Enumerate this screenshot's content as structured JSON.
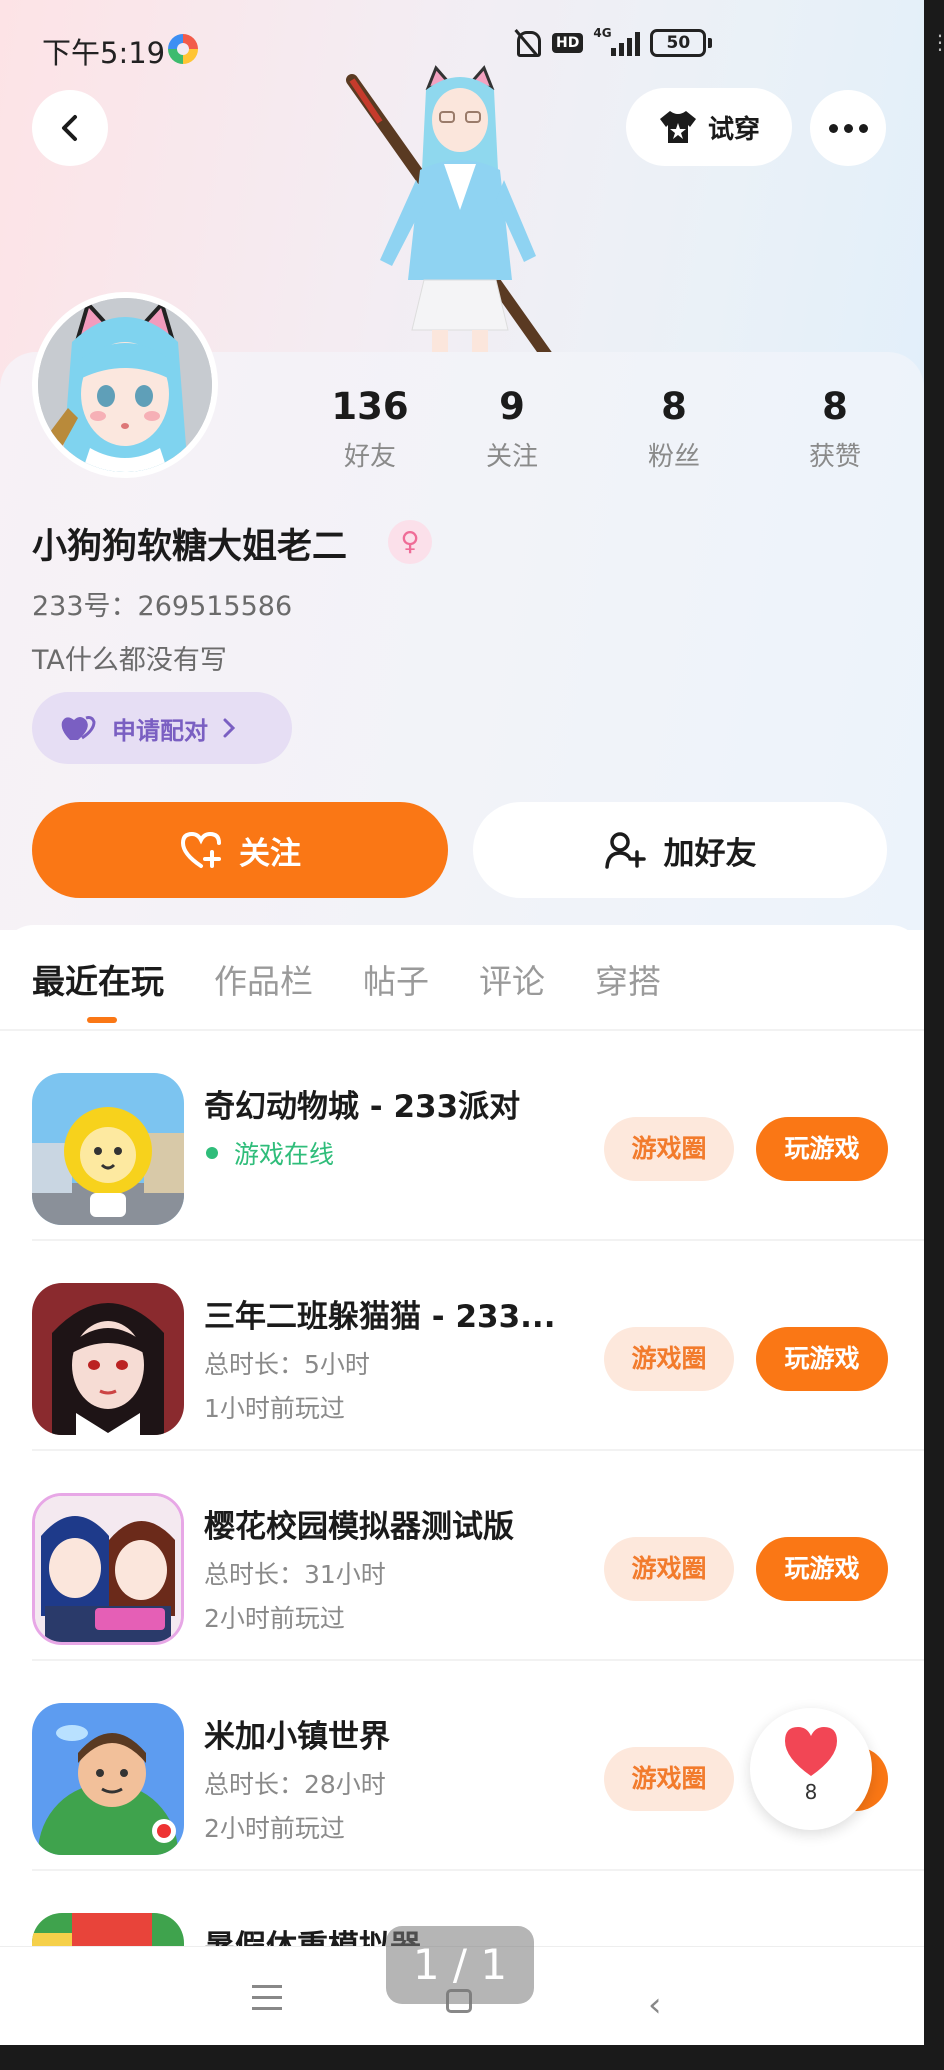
{
  "status_bar": {
    "time": "下午5:19",
    "hd": "HD",
    "network": "4G",
    "battery": "50"
  },
  "header": {
    "tryon_label": "试穿"
  },
  "profile": {
    "stats": [
      {
        "value": "136",
        "label": "好友"
      },
      {
        "value": "9",
        "label": "关注"
      },
      {
        "value": "8",
        "label": "粉丝"
      },
      {
        "value": "8",
        "label": "获赞"
      }
    ],
    "nickname": "小狗狗软糖大姐老二",
    "gender_symbol": "♀",
    "user_id": "233号：269515586",
    "bio": "TA什么都没有写",
    "pair_label": "申请配对",
    "follow_label": "关注",
    "add_friend_label": "加好友"
  },
  "tabs": [
    {
      "label": "最近在玩",
      "active": true
    },
    {
      "label": "作品栏",
      "active": false
    },
    {
      "label": "帖子",
      "active": false
    },
    {
      "label": "评论",
      "active": false
    },
    {
      "label": "穿搭",
      "active": false
    }
  ],
  "games": [
    {
      "title": "奇幻动物城 - 233派对",
      "status": "游戏在线",
      "circle_label": "游戏圈",
      "play_label": "玩游戏"
    },
    {
      "title": "三年二班躲猫猫 - 233...",
      "duration": "总时长：5小时",
      "last_played": "1小时前玩过",
      "circle_label": "游戏圈",
      "play_label": "玩游戏"
    },
    {
      "title": "樱花校园模拟器测试版",
      "duration": "总时长：31小时",
      "last_played": "2小时前玩过",
      "circle_label": "游戏圈",
      "play_label": "玩游戏"
    },
    {
      "title": "米加小镇世界",
      "duration": "总时长：28小时",
      "last_played": "2小时前玩过",
      "circle_label": "游戏圈",
      "play_label": ""
    },
    {
      "title": "暑假体重模拟器"
    }
  ],
  "float_like": {
    "count": "8"
  },
  "page_indicator": "1 / 1",
  "colors": {
    "accent": "#fa7715",
    "pair_purple": "#7a5fc2",
    "online_green": "#2fbd7a"
  }
}
